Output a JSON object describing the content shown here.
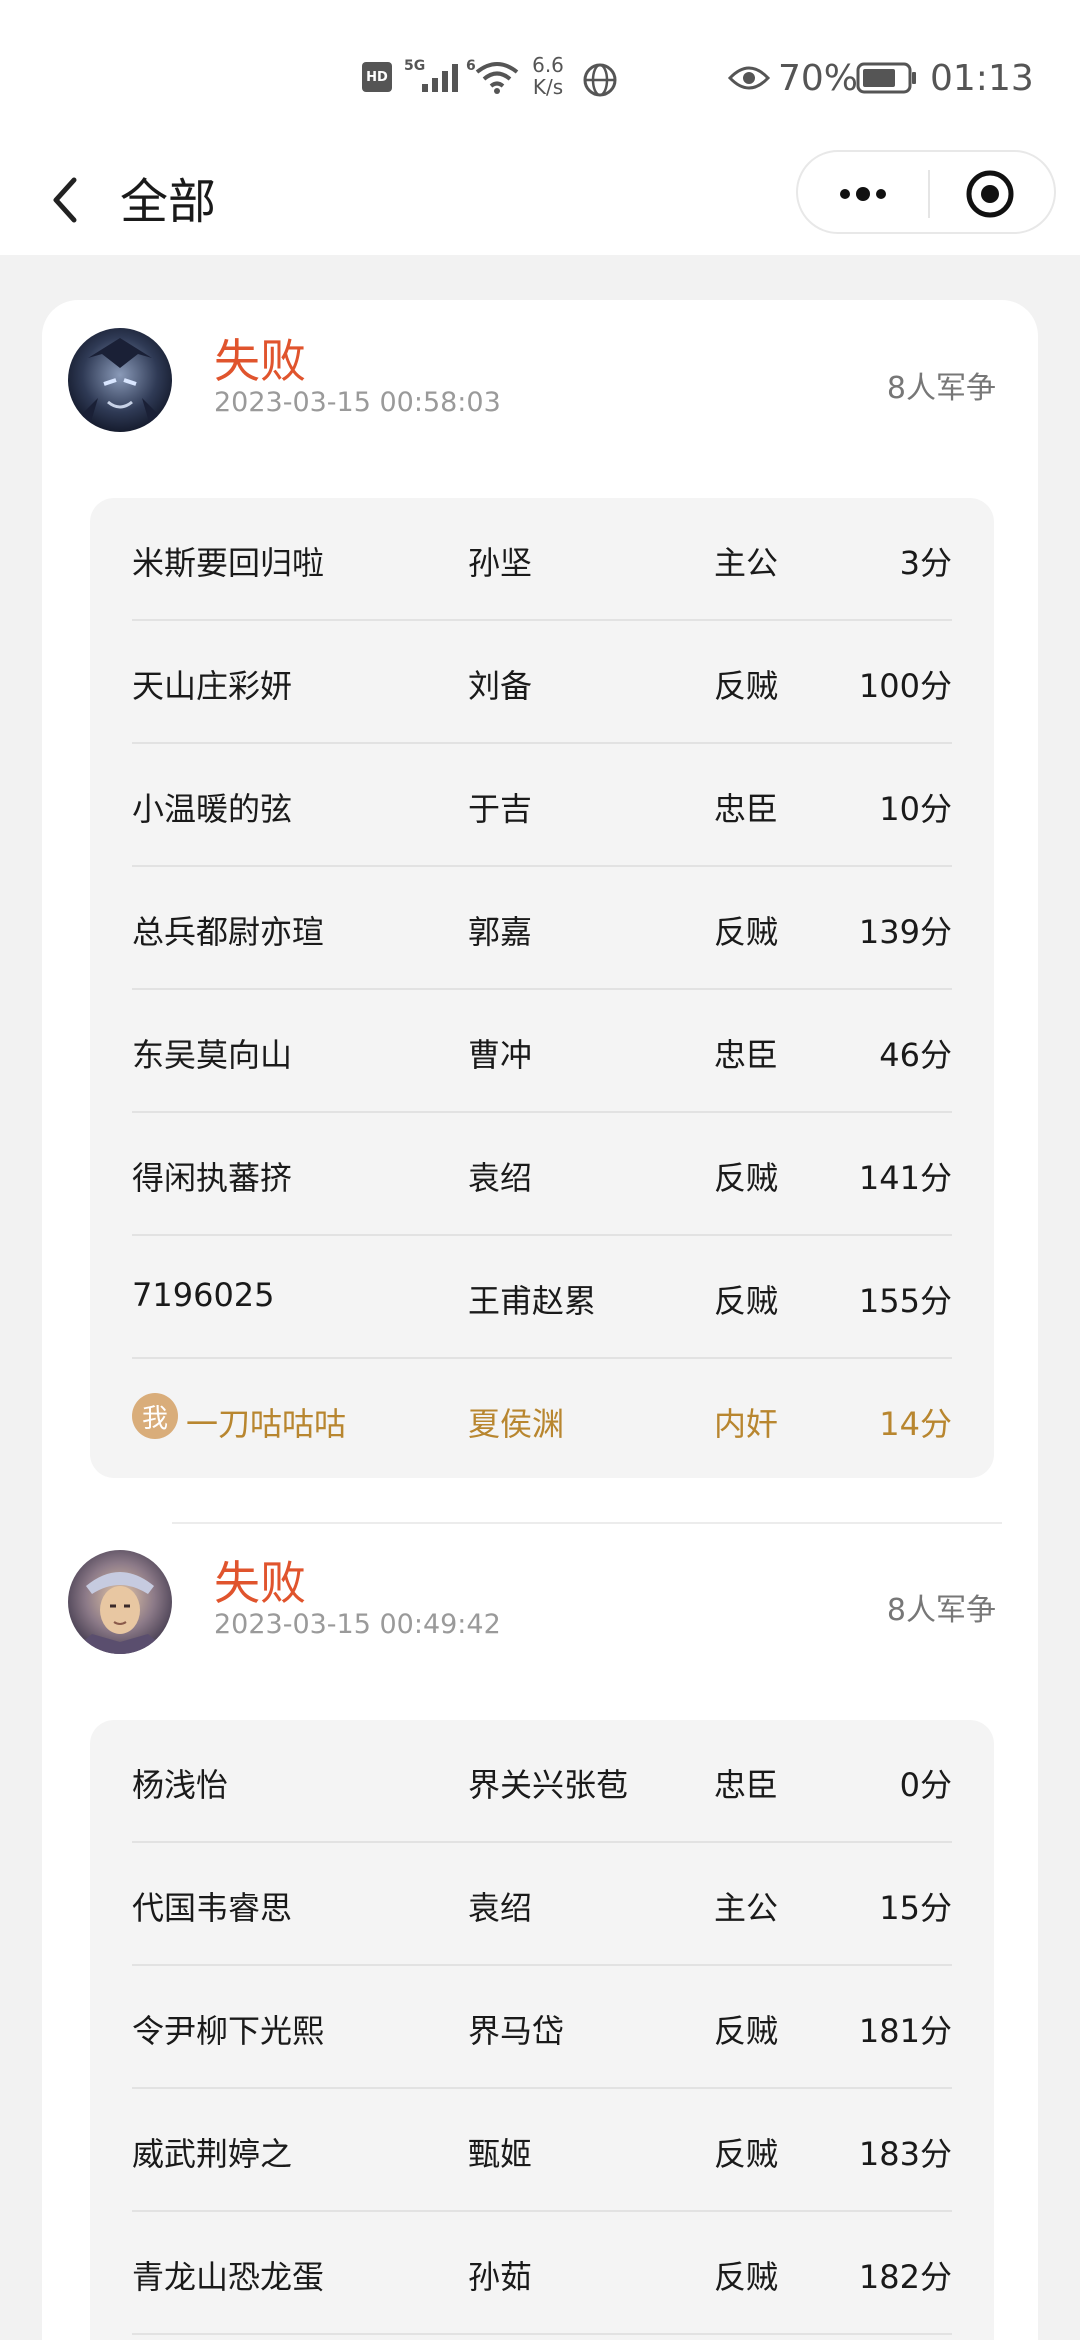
{
  "status_bar": {
    "hd": "HD",
    "net_5g": "5G",
    "net_6": "6",
    "speed_value": "6.6",
    "speed_unit": "K/s",
    "battery_pct": "70%",
    "time": "01:13"
  },
  "nav": {
    "title": "全部",
    "back_icon": "chevron-left-icon",
    "more_icon": "more-dots-icon",
    "close_icon": "target-close-icon"
  },
  "matches": [
    {
      "result": "失败",
      "time": "2023-03-15 00:58:03",
      "mode": "8人军争",
      "players": [
        {
          "name": "米斯要回归啦",
          "hero": "孙坚",
          "role": "主公",
          "score": "3分"
        },
        {
          "name": "天山庄彩妍",
          "hero": "刘备",
          "role": "反贼",
          "score": "100分"
        },
        {
          "name": "小温暖的弦",
          "hero": "于吉",
          "role": "忠臣",
          "score": "10分"
        },
        {
          "name": "总兵都尉亦瑄",
          "hero": "郭嘉",
          "role": "反贼",
          "score": "139分"
        },
        {
          "name": "东吴莫向山",
          "hero": "曹冲",
          "role": "忠臣",
          "score": "46分"
        },
        {
          "name": "得闲执蕃挤",
          "hero": "袁绍",
          "role": "反贼",
          "score": "141分"
        },
        {
          "name": "7196025",
          "hero": "王甫赵累",
          "role": "反贼",
          "score": "155分"
        },
        {
          "name": "一刀咕咕咕",
          "hero": "夏侯渊",
          "role": "内奸",
          "score": "14分",
          "me_badge": "我"
        }
      ]
    },
    {
      "result": "失败",
      "time": "2023-03-15 00:49:42",
      "mode": "8人军争",
      "players": [
        {
          "name": "杨浅怡",
          "hero": "界关兴张苞",
          "role": "忠臣",
          "score": "0分"
        },
        {
          "name": "代国韦睿思",
          "hero": "袁绍",
          "role": "主公",
          "score": "15分"
        },
        {
          "name": "令尹柳下光熙",
          "hero": "界马岱",
          "role": "反贼",
          "score": "181分"
        },
        {
          "name": "威武荆婷之",
          "hero": "甄姬",
          "role": "反贼",
          "score": "183分"
        },
        {
          "name": "青龙山恐龙蛋",
          "hero": "孙茹",
          "role": "反贼",
          "score": "182分"
        }
      ]
    }
  ],
  "colors": {
    "loss": "#e0542d",
    "me": "#b8862f",
    "card_bg": "#ffffff",
    "table_bg": "#f4f4f4"
  }
}
